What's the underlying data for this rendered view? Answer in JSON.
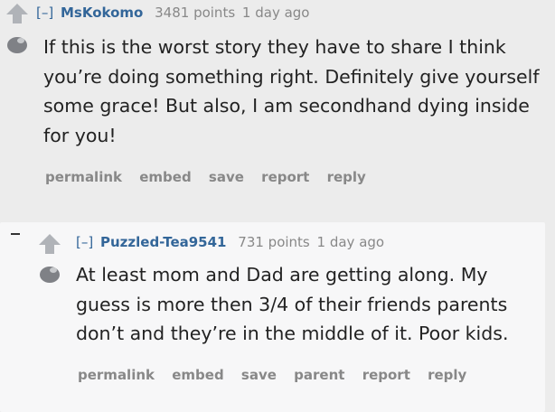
{
  "top_comment": {
    "collapse_label": "[–]",
    "author": "MsKokomo",
    "score": "3481 points",
    "age": "1 day ago",
    "body": "If this is the worst story they have to share I think you’re doing something right. Definitely give yourself some grace! But also, I am secondhand dying inside for you!",
    "actions": [
      "permalink",
      "embed",
      "save",
      "report",
      "reply"
    ]
  },
  "child_comment": {
    "collapse_label": "[–]",
    "author": "Puzzled-Tea9541",
    "score": "731 points",
    "age": "1 day ago",
    "body": "At least mom and Dad are getting along. My guess is more then 3/4 of their friends parents don’t and they’re in the middle of it. Poor kids.",
    "actions": [
      "permalink",
      "embed",
      "save",
      "parent",
      "report",
      "reply"
    ]
  },
  "colors": {
    "upvote_arrow": "#b0b3b8",
    "author_link": "#336699",
    "meta_text": "#888888",
    "body_text": "#222222"
  }
}
